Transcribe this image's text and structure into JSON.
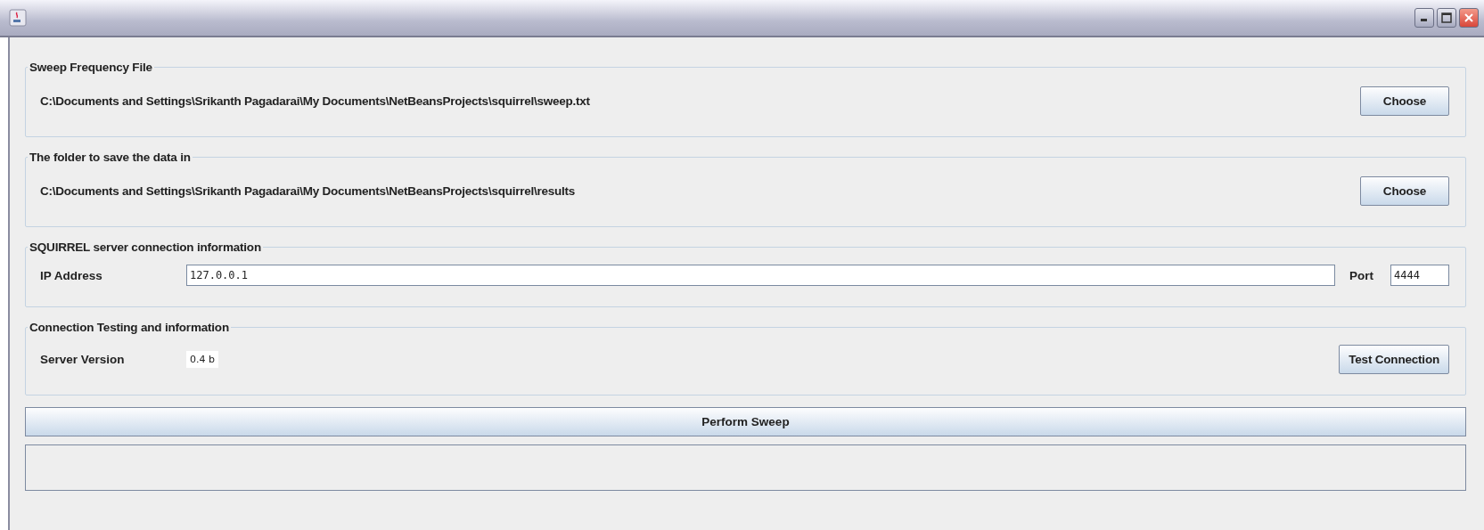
{
  "sections": [
    {
      "kind": "file",
      "title": "Sweep Frequency File",
      "path": "C:\\Documents and Settings\\Srikanth Pagadarai\\My Documents\\NetBeansProjects\\squirrel\\sweep.txt",
      "button": "Choose"
    },
    {
      "kind": "file",
      "title": "The folder to save the data in",
      "path": "C:\\Documents and Settings\\Srikanth Pagadarai\\My Documents\\NetBeansProjects\\squirrel\\results",
      "button": "Choose"
    },
    {
      "kind": "server",
      "title": "SQUIRREL server connection information",
      "ip_label": "IP Address",
      "ip_value": "127.0.0.1",
      "port_label": "Port",
      "port_value": "4444"
    },
    {
      "kind": "test",
      "title": "Connection Testing and information",
      "version_label": "Server Version",
      "version_value": "0.4 b",
      "button": "Test Connection"
    }
  ],
  "sweep_button": "Perform Sweep"
}
